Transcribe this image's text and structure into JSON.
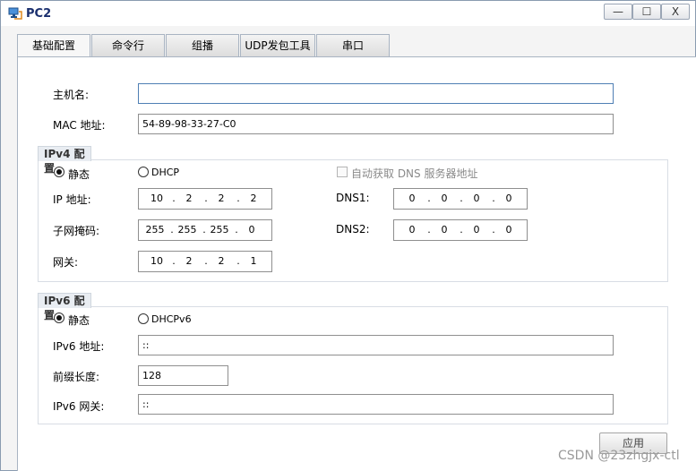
{
  "window": {
    "title": "PC2",
    "min": "—",
    "max": "☐",
    "close": "X"
  },
  "tabs": [
    "基础配置",
    "命令行",
    "组播",
    "UDP发包工具",
    "串口"
  ],
  "host": {
    "label": "主机名:",
    "value": ""
  },
  "mac": {
    "label": "MAC 地址:",
    "value": "54-89-98-33-27-C0"
  },
  "ipv4": {
    "title": "IPv4 配置",
    "static_label": "静态",
    "dhcp_label": "DHCP",
    "auto_dns_label": "自动获取 DNS 服务器地址",
    "ip_label": "IP 地址:",
    "ip": [
      "10",
      "2",
      "2",
      "2"
    ],
    "mask_label": "子网掩码:",
    "mask": [
      "255",
      "255",
      "255",
      "0"
    ],
    "gw_label": "网关:",
    "gw": [
      "10",
      "2",
      "2",
      "1"
    ],
    "dns1_label": "DNS1:",
    "dns1": [
      "0",
      "0",
      "0",
      "0"
    ],
    "dns2_label": "DNS2:",
    "dns2": [
      "0",
      "0",
      "0",
      "0"
    ]
  },
  "ipv6": {
    "title": "IPv6 配置",
    "static_label": "静态",
    "dhcp_label": "DHCPv6",
    "addr_label": "IPv6 地址:",
    "addr": "::",
    "prefix_label": "前缀长度:",
    "prefix": "128",
    "gw_label": "IPv6 网关:",
    "gw": "::"
  },
  "apply_label": "应用",
  "watermark": "CSDN @23zhgjx-ctl"
}
